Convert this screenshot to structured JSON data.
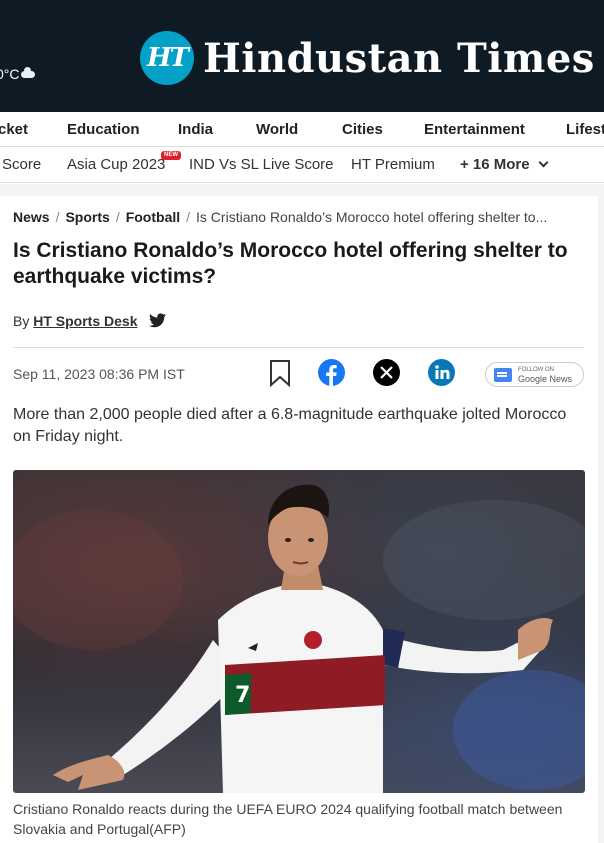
{
  "header": {
    "weather_text": "0°C",
    "logo_mark": "HT",
    "logo_name": "Hindustan Times",
    "brand_color": "#0f1b24",
    "logo_color": "#03a0c8"
  },
  "nav_primary": [
    "cket",
    "Education",
    "India",
    "World",
    "Cities",
    "Entertainment",
    "Lifest"
  ],
  "nav_secondary": {
    "items": [
      "Score",
      "Asia Cup 2023",
      "IND Vs SL Live Score",
      "HT Premium"
    ],
    "new_badge": "NEW",
    "more_label": "+ 16 More"
  },
  "breadcrumb": {
    "items": [
      "News",
      "Sports",
      "Football"
    ],
    "current": "Is Cristiano Ronaldo’s Morocco hotel offering shelter to..."
  },
  "article": {
    "headline": "Is Cristiano Ronaldo’s Morocco hotel offering shelter to earthquake victims?",
    "by_prefix": "By",
    "author": "HT Sports Desk",
    "date": "Sep 11, 2023 08:36 PM IST",
    "summary": "More than 2,000 people died after a 6.8-magnitude earthquake jolted Morocco on Friday night.",
    "caption": "Cristiano Ronaldo reacts during the UEFA EURO 2024 qualifying football match between Slovakia and Portugal(AFP)"
  },
  "share": {
    "icons": [
      "bookmark-icon",
      "facebook-icon",
      "x-icon",
      "linkedin-icon"
    ],
    "google_news_small": "FOLLOW ON",
    "google_news_label": "Google News"
  }
}
